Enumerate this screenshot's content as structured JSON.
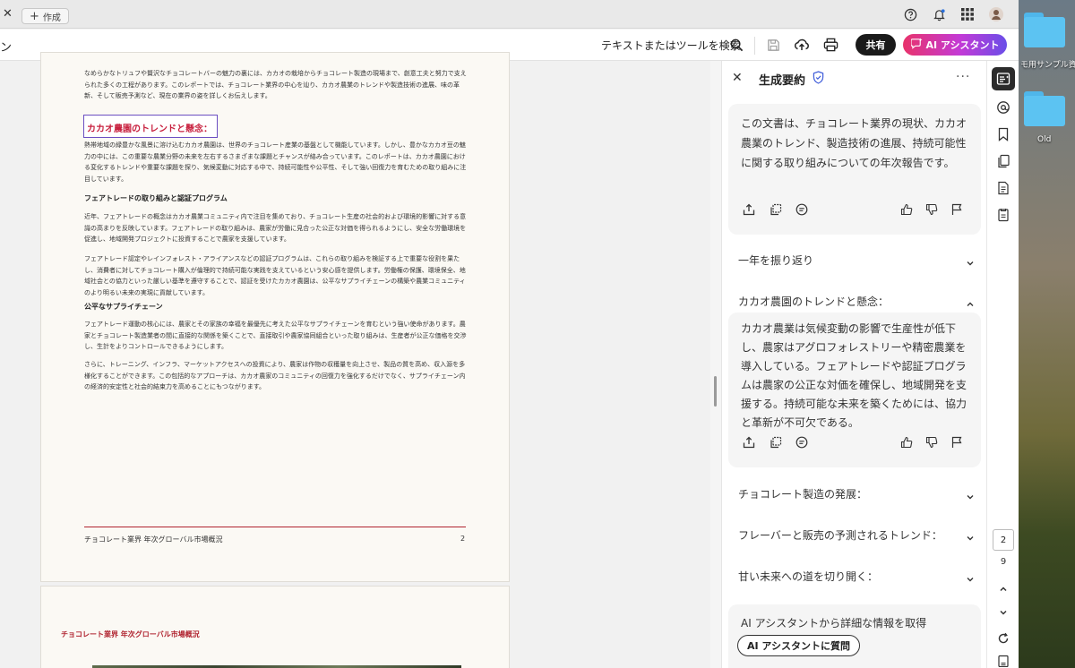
{
  "desktop": {
    "folder1_label": "モ用サンプル資料",
    "folder2_label": "Old"
  },
  "tabbar": {
    "new_tab_label": "作成"
  },
  "toolbar": {
    "left_fragment": "ン",
    "search_label": "テキストまたはツールを検索",
    "share_label": "共有",
    "ai_label": "AI アシスタント"
  },
  "document": {
    "page1": {
      "intro": "なめらかなトリュフや贅沢なチョコレートバーの魅力の裏には、カカオの栽培からチョコレート製造の現場まで、創意工夫と努力で支えられた多くの工程があります。このレポートでは、チョコレート業界の中心を辿り、カカオ農業のトレンドや製造技術の進展、味の革新、そして販売予測など、現在の業界の姿を詳しくお伝えします。",
      "highlight_heading": "カカオ農園のトレンドと懸念：",
      "para1": "熱帯地域の緑豊かな風景に溶け込むカカオ農園は、世界のチョコレート産業の基盤として機能しています。しかし、豊かなカカオ豆の魅力の中には、この重要な農業分野の未来を左右するさまざまな課題とチャンスが絡み合っています。このレポートは、カカオ農園における変化するトレンドや重要な課題を探り、気候変動に対応する中で、持続可能性や公平性、そして強い回復力を育むための取り組みに注目しています。",
      "heading2": "フェアトレードの取り組みと認証プログラム",
      "para2": "近年、フェアトレードの概念はカカオ農業コミュニティ内で注目を集めており、チョコレート生産の社会的および環境的影響に対する意識の高まりを反映しています。フェアトレードの取り組みは、農家が労働に見合った公正な対価を得られるようにし、安全な労働環境を促進し、地域開発プロジェクトに投資することで農家を支援しています。",
      "para3": "フェアトレード認定やレインフォレスト・アライアンスなどの認証プログラムは、これらの取り組みを検証する上で重要な役割を果たし、消費者に対してチョコレート購入が倫理的で持続可能な実践を支えているという安心感を提供します。労働権の保護、環境保全、地域社会との協力といった厳しい基準を遵守することで、認証を受けたカカオ農園は、公平なサプライチェーンの構築や農業コミュニティのより明るい未来の実現に貢献しています。",
      "heading3": "公平なサプライチェーン",
      "para4": "フェアトレード運動の核心には、農家とその家族の幸福を最優先に考えた公平なサプライチェーンを育むという強い使命があります。農家とチョコレート製造業者の間に直接的な関係を築くことで、直接取引や農家協同組合といった取り組みは、生産者が公正な価格を交渉し、生計をよりコントロールできるようにします。",
      "para5": "さらに、トレーニング、インフラ、マーケットアクセスへの投資により、農家は作物の収穫量を向上させ、製品の質を高め、収入源を多様化することができます。この包括的なアプローチは、カカオ農家のコミュニティの回復力を強化するだけでなく、サプライチェーン内の経済的安定性と社会的結束力を高めることにもつながります。",
      "footer_title": "チョコレート業界 年次グローバル市場概況",
      "footer_page": "2"
    },
    "page2": {
      "header_title": "チョコレート業界 年次グローバル市場概況"
    }
  },
  "panel": {
    "title": "生成要約",
    "summary": "この文書は、チョコレート業界の現状、カカオ農業のトレンド、製造技術の進展、持続可能性に関する取り組みについての年次報告です。",
    "sections": [
      {
        "label": "一年を振り返り"
      },
      {
        "label": "カカオ農園のトレンドと懸念："
      },
      {
        "label": "チョコレート製造の発展："
      },
      {
        "label": "フレーバーと販売の予測されるトレンド："
      },
      {
        "label": "甘い未来への道を切り開く："
      }
    ],
    "expanded_text": "カカオ農業は気候変動の影響で生産性が低下し、農家はアグロフォレストリーや精密農業を導入している。フェアトレードや認証プログラムは農家の公正な対価を確保し、地域開発を支援する。持続可能な未来を築くためには、協力と革新が不可欠である。",
    "cta_title": "AI アシスタントから詳細な情報を取得",
    "cta_button": "AI アシスタントに質問"
  },
  "rail": {
    "current_page": "2",
    "total_pages": "9"
  }
}
